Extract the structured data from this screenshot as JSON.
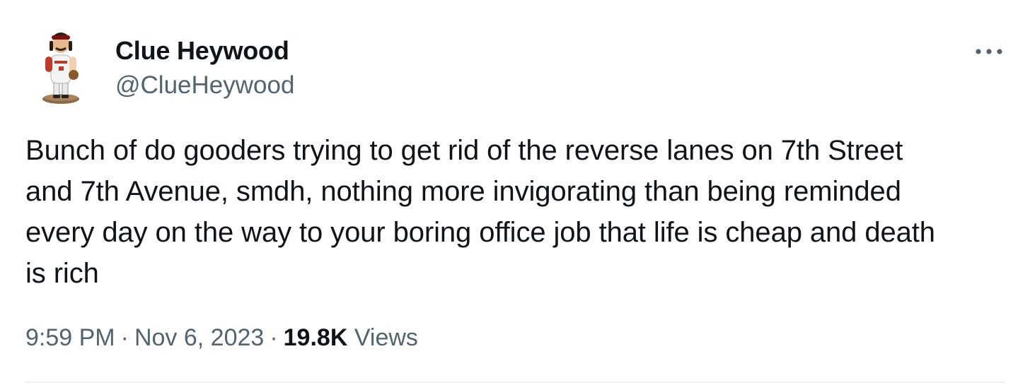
{
  "author": {
    "display_name": "Clue Heywood",
    "handle": "@ClueHeywood",
    "avatar_icon": "bobblehead-avatar-icon"
  },
  "menu": {
    "more_icon": "more-dots-icon"
  },
  "tweet": {
    "text": "Bunch of do gooders trying to get rid of the reverse lanes on 7th Street\nand 7th Avenue, smdh, nothing more invigorating than being reminded\nevery day on the way to your boring office job that life is cheap and death\nis rich"
  },
  "meta": {
    "time": "9:59 PM",
    "separator": "·",
    "date": "Nov 6, 2023",
    "views_count": "19.8K",
    "views_label": "Views"
  },
  "colors": {
    "primary_text": "#0f1419",
    "secondary_text": "#536471",
    "divider": "#eff3f4"
  }
}
